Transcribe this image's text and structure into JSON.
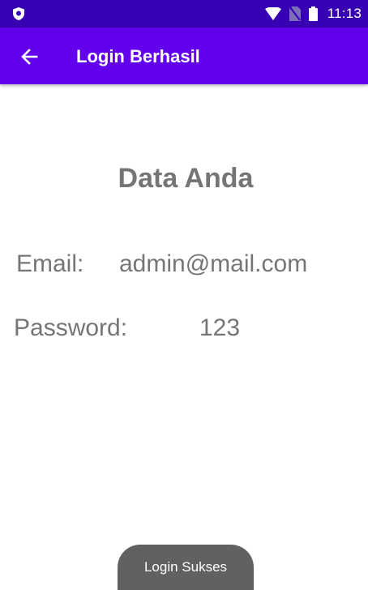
{
  "status_bar": {
    "time": "11:13",
    "icons": [
      "shield-icon",
      "wifi-icon",
      "no-sim-icon",
      "battery-icon"
    ]
  },
  "app_bar": {
    "title": "Login Berhasil",
    "back_icon": "arrow-back-icon",
    "color": "#6200ee",
    "status_color": "#3700b3"
  },
  "content": {
    "heading": "Data Anda",
    "email_label": "Email:",
    "email_value": "admin@mail.com",
    "password_label": "Password:",
    "password_value": "123",
    "text_color": "#757575"
  },
  "toast": {
    "message": "Login Sukses"
  }
}
